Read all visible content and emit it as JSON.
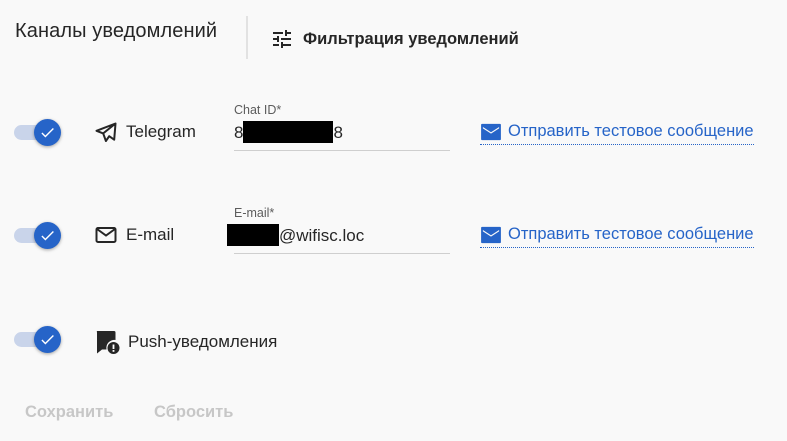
{
  "header": {
    "title": "Каналы уведомлений",
    "filter_label": "Фильтрация уведомлений"
  },
  "channels": [
    {
      "name": "Telegram",
      "enabled": true,
      "icon": "telegram-send-icon",
      "field_label": "Chat ID*",
      "value_prefix": "8",
      "value_suffix": "8",
      "test_label": "Отправить тестовое сообщение"
    },
    {
      "name": "E-mail",
      "enabled": true,
      "icon": "envelope-icon",
      "field_label": "E-mail*",
      "value_prefix": "",
      "value_suffix": "@wifisc.loc",
      "test_label": "Отправить тестовое сообщение"
    },
    {
      "name": "Push-уведомления",
      "enabled": true,
      "icon": "push-notification-icon"
    }
  ],
  "footer": {
    "save_label": "Сохранить",
    "reset_label": "Сбросить"
  },
  "colors": {
    "accent": "#2664c8",
    "toggle_track": "#c9d4ea",
    "disabled_text": "#c7c7c7"
  }
}
